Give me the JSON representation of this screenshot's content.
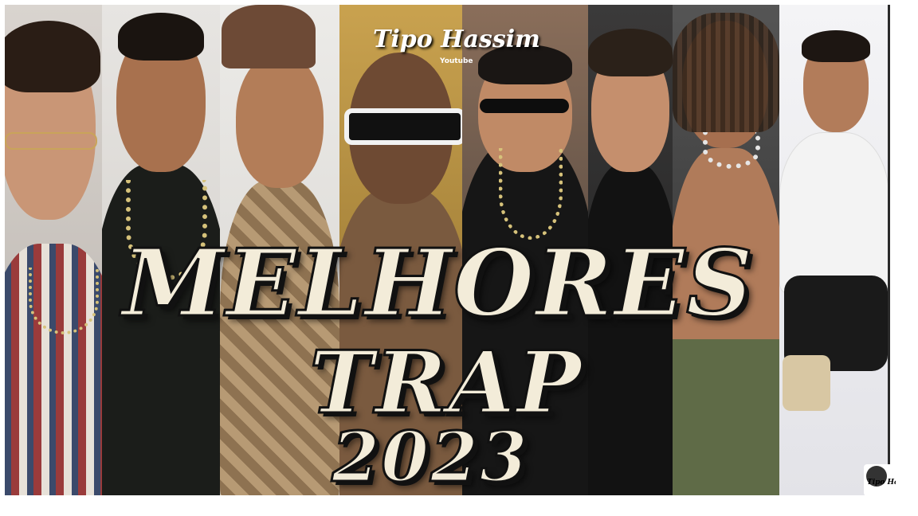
{
  "thumbnail": {
    "channel_name": "Tipo Hassim",
    "channel_sub": "Youtube",
    "title_line1": "MELHORES",
    "title_line2": "TRAP",
    "title_line3": "2023",
    "watermark_text": "Tipo Hassim",
    "colors": {
      "title_fill": "#f3ecd9",
      "title_stroke": "#111111"
    }
  }
}
